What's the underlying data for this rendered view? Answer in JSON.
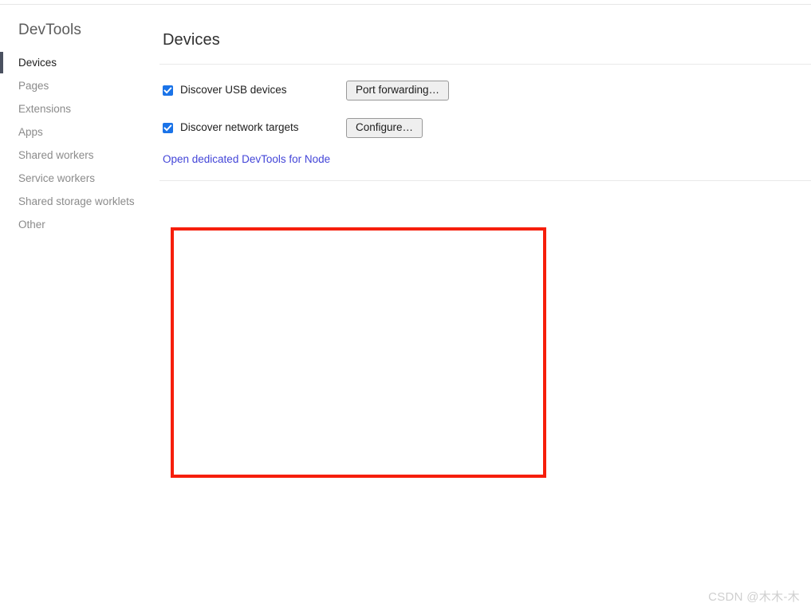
{
  "sidebar": {
    "title": "DevTools",
    "items": [
      {
        "label": "Devices",
        "selected": true
      },
      {
        "label": "Pages",
        "selected": false
      },
      {
        "label": "Extensions",
        "selected": false
      },
      {
        "label": "Apps",
        "selected": false
      },
      {
        "label": "Shared workers",
        "selected": false
      },
      {
        "label": "Service workers",
        "selected": false
      },
      {
        "label": "Shared storage worklets",
        "selected": false
      },
      {
        "label": "Other",
        "selected": false
      }
    ]
  },
  "main": {
    "title": "Devices",
    "settings": [
      {
        "checkbox_label": "Discover USB devices",
        "checked": true,
        "button_label": "Port forwarding…"
      },
      {
        "checkbox_label": "Discover network targets",
        "checked": true,
        "button_label": "Configure…"
      }
    ],
    "node_link_label": "Open dedicated DevTools for Node"
  },
  "annotation": {
    "color": "#f61e0b",
    "shape": "rectangle"
  },
  "watermark": {
    "text": "CSDN @木木-木"
  },
  "colors": {
    "accent_checkbox": "#1a73e8",
    "link": "#4345d8",
    "selected_indicator": "#4a5160",
    "divider": "#e9e9e9",
    "annotation_red": "#f61e0b",
    "watermark_gray": "#cfcfcf"
  }
}
